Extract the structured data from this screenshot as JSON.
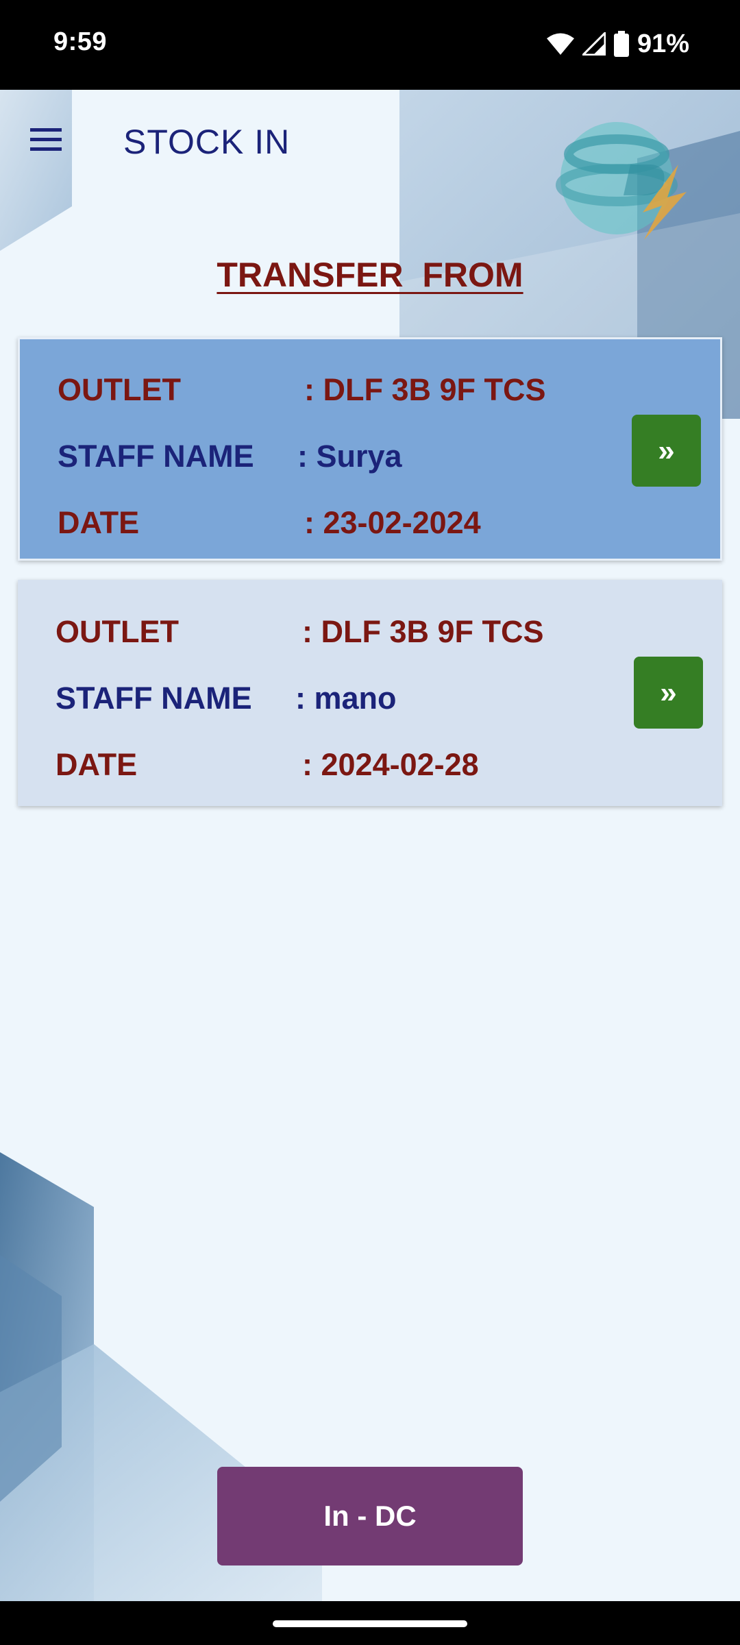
{
  "status_bar": {
    "time": "9:59",
    "battery": "91%",
    "icons": [
      "wifi-icon",
      "signal-icon",
      "battery-icon"
    ]
  },
  "app_bar": {
    "title": "STOCK IN",
    "menu_icon": "menu-icon",
    "logo_icon": "company-logo"
  },
  "section": {
    "title": "TRANSFER  FROM"
  },
  "transfers": [
    {
      "outlet_label": "OUTLET",
      "outlet_value": ": DLF 3B 9F TCS",
      "staff_label": "STAFF NAME",
      "staff_value": ": Surya",
      "date_label": "DATE",
      "date_value": ": 23-02-2024",
      "button_label": "»"
    },
    {
      "outlet_label": "OUTLET",
      "outlet_value": ": DLF 3B 9F TCS",
      "staff_label": "STAFF NAME",
      "staff_value": ": mano",
      "date_label": "DATE",
      "date_value": ": 2024-02-28",
      "button_label": "»"
    }
  ],
  "action": {
    "label": "In - DC"
  },
  "colors": {
    "primary_text": "#1b2379",
    "accent_text": "#7b1712",
    "go_button": "#357e24",
    "action_button": "#733b73",
    "card_selected": "#7ba6d8",
    "card": "#d6e1f0"
  }
}
